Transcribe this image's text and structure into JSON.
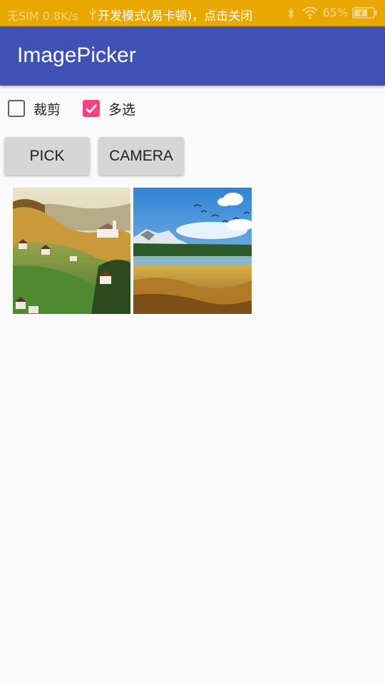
{
  "status_bar": {
    "carrier": "无SIM",
    "net_speed": "0.8K/s",
    "notice": "开发模式(易卡顿)，点击关闭",
    "battery": "65%"
  },
  "app_bar": {
    "title": "ImagePicker",
    "color": "#3f51b5"
  },
  "options": {
    "crop": {
      "label": "裁剪",
      "checked": false
    },
    "multi": {
      "label": "多选",
      "checked": true
    }
  },
  "buttons": {
    "pick_label": "PICK",
    "camera_label": "CAMERA"
  },
  "thumbnails": [
    {
      "name": "village-hillside-photo"
    },
    {
      "name": "mountain-lake-photo"
    }
  ],
  "colors": {
    "status_bar": "#e8a800",
    "accent": "#ff4081",
    "background": "#fafafa"
  }
}
